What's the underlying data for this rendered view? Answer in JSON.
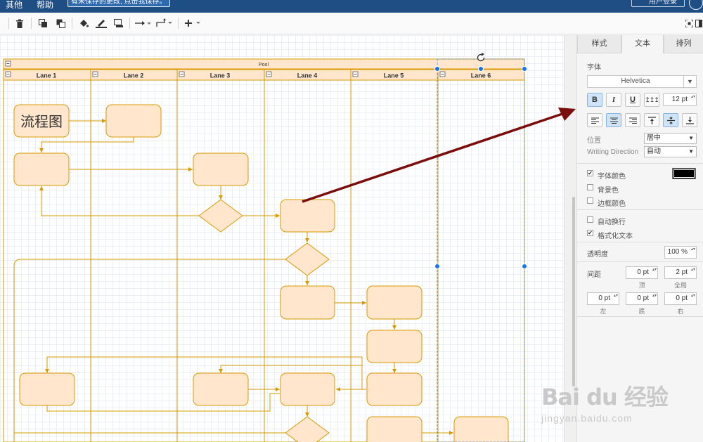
{
  "menubar": {
    "items": [
      "其他",
      "帮助"
    ],
    "notice": "有未保存的更改, 点击我保存。",
    "login": "用户登录"
  },
  "toolbar": {
    "icons": [
      "delete-icon",
      "to-front-icon",
      "to-back-icon",
      "fill-color-icon",
      "line-color-icon",
      "shadow-icon",
      "connection-icon",
      "waypoints-icon",
      "insert-icon",
      "fullscreen-icon",
      "format-panel-icon"
    ]
  },
  "diagram": {
    "pool_label": "Pool",
    "lanes": [
      "Lane 1",
      "Lane 2",
      "Lane 3",
      "Lane 4",
      "Lane 5",
      "Lane 6"
    ],
    "first_shape_text": "流程图",
    "colors": {
      "fill": "#ffe6cc",
      "stroke": "#d79b00",
      "lane_header": "#ffe6cc",
      "arrow": "#7b0d0d",
      "selection": "#1a73e8"
    }
  },
  "panel": {
    "tabs": [
      "样式",
      "文本",
      "排列"
    ],
    "active_tab": "文本",
    "font_label": "字体",
    "font_family": "Helvetica",
    "style_buttons": [
      "B",
      "I",
      "U",
      "↥↥↥"
    ],
    "font_size": "12 pt",
    "position_label": "位置",
    "position_value": "居中",
    "writing_direction_label": "Writing Direction",
    "writing_direction_value": "自动",
    "font_color_label": "字体颜色",
    "font_color_checked": true,
    "font_color": "#000000",
    "background_color_label": "背景色",
    "border_color_label": "边框颜色",
    "auto_wrap_label": "自动换行",
    "formatted_text_label": "格式化文本",
    "formatted_text_checked": true,
    "opacity_label": "透明度",
    "opacity_value": "100 %",
    "spacing_label": "间距",
    "spacing": {
      "top_value": "0 pt",
      "top_caption": "顶",
      "global_value": "2 pt",
      "global_caption": "全局",
      "left_value": "0 pt",
      "left_caption": "左",
      "bottom_value": "0 pt",
      "bottom_caption": "底",
      "right_value": "0 pt",
      "right_caption": "右"
    }
  },
  "watermark": {
    "brand": "Bai du 经验",
    "url": "jingyan.baidu.com"
  }
}
